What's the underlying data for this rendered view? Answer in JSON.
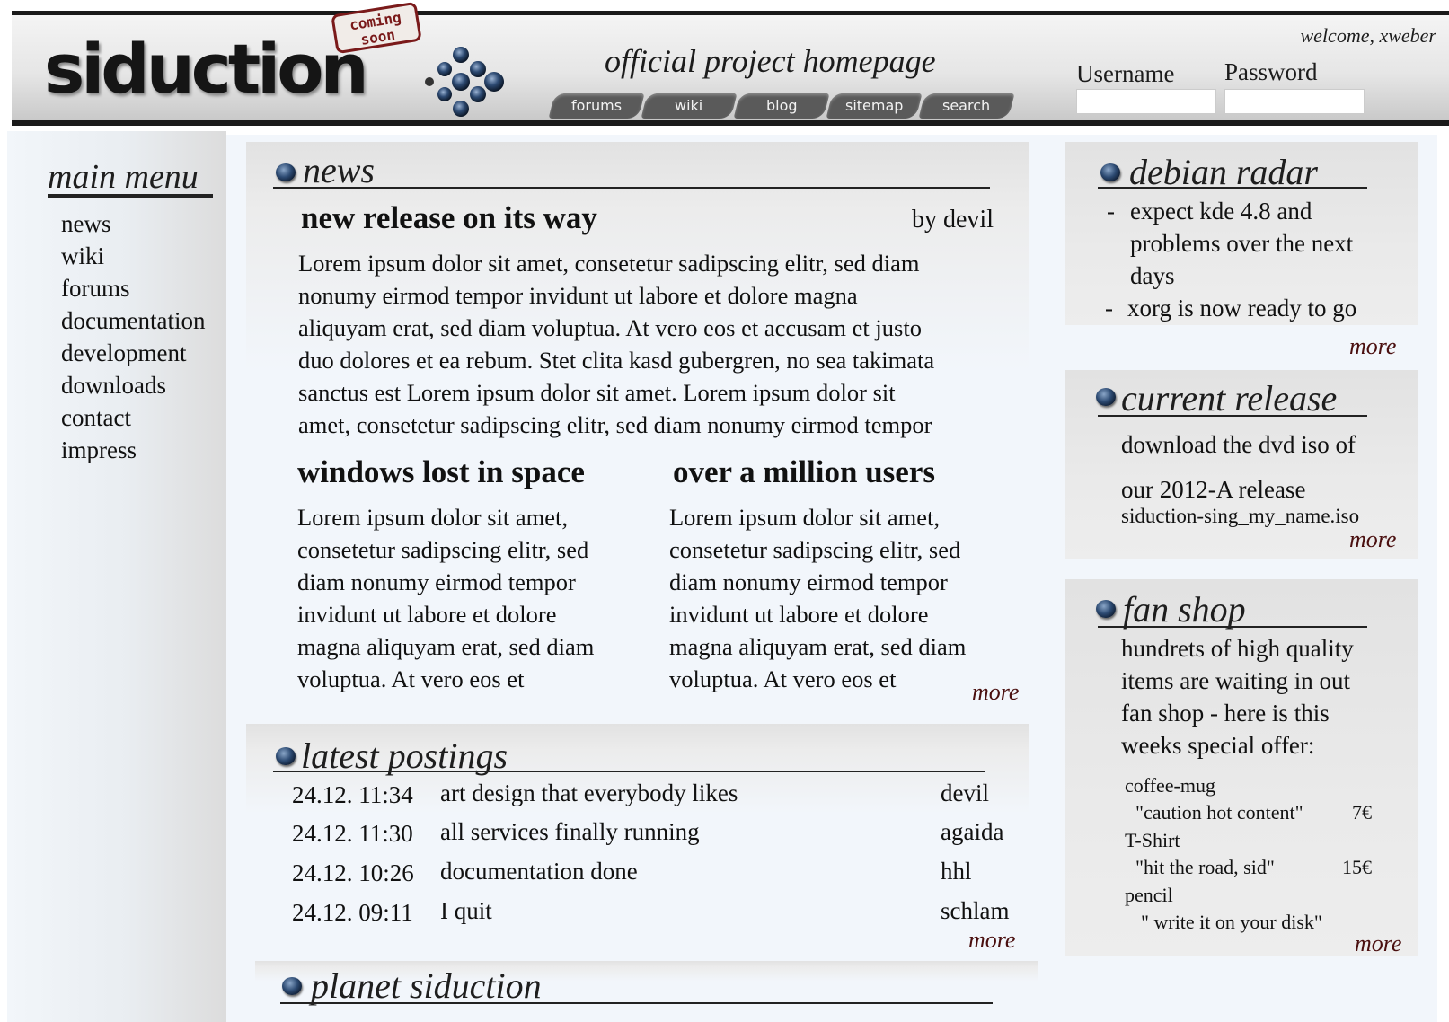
{
  "header": {
    "logo_text": "siduction",
    "stamp_line1": "coming",
    "stamp_line2": "soon",
    "tagline": "official project homepage",
    "welcome": "welcome, xweber",
    "username_label": "Username",
    "password_label": "Password",
    "nav": [
      "forums",
      "wiki",
      "blog",
      "sitemap",
      "search"
    ]
  },
  "main_menu": {
    "title": "main menu",
    "items": [
      "news",
      "wiki",
      "forums",
      "documentation",
      "development",
      "downloads",
      "contact",
      "impress"
    ]
  },
  "news": {
    "title": "news",
    "lead": {
      "headline": "new release on its way",
      "author": "by devil",
      "lines": [
        "Lorem ipsum dolor sit amet, consetetur sadipscing elitr, sed diam",
        "nonumy eirmod tempor invidunt ut labore et dolore magna",
        "aliquyam erat, sed diam voluptua. At vero eos et accusam et justo",
        "duo dolores et ea rebum. Stet clita kasd gubergren, no sea takimata",
        "sanctus est Lorem ipsum dolor sit amet. Lorem ipsum dolor sit",
        "amet, consetetur sadipscing elitr, sed diam nonumy eirmod tempor"
      ]
    },
    "col1": {
      "headline": "windows lost in space",
      "lines": [
        "Lorem ipsum dolor sit amet,",
        "consetetur sadipscing elitr, sed",
        "diam nonumy eirmod tempor",
        "invidunt ut labore et dolore",
        "magna aliquyam erat, sed diam",
        "voluptua. At vero eos et"
      ]
    },
    "col2": {
      "headline": "over a million users",
      "lines": [
        "Lorem ipsum dolor sit amet,",
        "consetetur sadipscing elitr, sed",
        "diam nonumy eirmod tempor",
        "invidunt ut labore et dolore",
        "magna aliquyam erat, sed diam",
        "voluptua. At vero eos et"
      ]
    },
    "more": "more"
  },
  "latest_postings": {
    "title": "latest postings",
    "rows": [
      {
        "time": "24.12. 11:34",
        "subject": "art design that everybody likes",
        "author": "devil"
      },
      {
        "time": "24.12. 11:30",
        "subject": "all services finally running",
        "author": "agaida"
      },
      {
        "time": "24.12. 10:26",
        "subject": "documentation done",
        "author": "hhl"
      },
      {
        "time": "24.12. 09:11",
        "subject": "I quit",
        "author": "schlam"
      }
    ],
    "more": "more"
  },
  "planet": {
    "title": "planet siduction"
  },
  "debian_radar": {
    "title": "debian radar",
    "items": [
      {
        "bullet": "-",
        "lines": [
          "expect kde 4.8 and",
          "problems over the next",
          "days"
        ]
      },
      {
        "bullet": "-",
        "lines": [
          "xorg is now ready to go"
        ]
      }
    ],
    "more": "more"
  },
  "current_release": {
    "title": "current release",
    "lines": [
      "download the dvd iso of",
      "our 2012-A release"
    ],
    "file": "siduction-sing_my_name.iso",
    "more": "more"
  },
  "fan_shop": {
    "title": "fan shop",
    "lines": [
      "hundrets of high quality",
      "items are waiting in out",
      "fan shop - here is this",
      "weeks special offer:"
    ],
    "items": [
      {
        "name": "coffee-mug",
        "desc": "\"caution hot content\"",
        "price": "7€"
      },
      {
        "name": "T-Shirt",
        "desc": "\"hit the road, sid\"",
        "price": "15€"
      },
      {
        "name": "pencil",
        "desc": "\" write it on your disk\"",
        "price": ""
      }
    ],
    "more": "more"
  }
}
